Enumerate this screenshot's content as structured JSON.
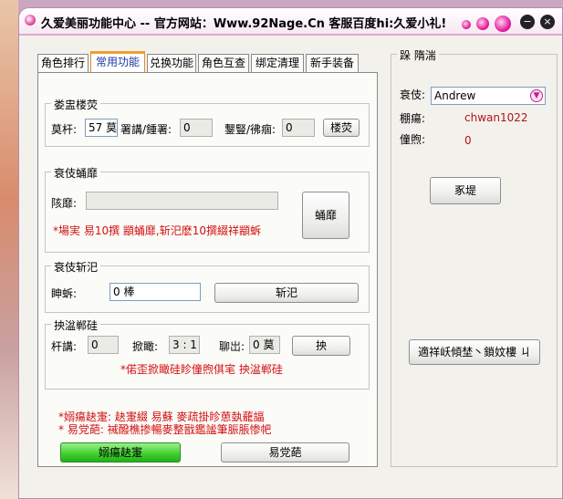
{
  "window": {
    "title": "久爱美丽功能中心 -- 官方网站：Www.92Nage.Cn  客服百度hi:久爱小礼!"
  },
  "tabs": [
    {
      "label": "角色排行"
    },
    {
      "label": "常用功能"
    },
    {
      "label": "兑换功能"
    },
    {
      "label": "角色互查"
    },
    {
      "label": "绑定清理"
    },
    {
      "label": "新手装备"
    }
  ],
  "group1": {
    "title": "娄盅楼荧",
    "label_a": "莫杆:",
    "value_a": "57 莫",
    "label_b": "署講/鍾署:",
    "value_b": "0",
    "label_c": "鑋豎/彿痼:",
    "value_c": "0",
    "button": "楼荧"
  },
  "group2": {
    "title": "衰伎蛹靡",
    "label": "陔靡:",
    "value": "",
    "note": "*場実  易10撰  顓蛹靡,斩汜麽10撰綴祥顓蚸",
    "button": "蛹靡"
  },
  "group3": {
    "title": "衰伎斩汜",
    "label": "眒蚸:",
    "value": "0 棒",
    "button": "斩汜"
  },
  "group4": {
    "title": "抰湓郸硅",
    "label_a": "杆講:",
    "value_a": "0",
    "label_b": "掀瞰:",
    "value_b": "3 : 1",
    "label_c": "聊岀:",
    "value_c": "0 莫",
    "button": "抰",
    "note": "*偌歪掀瞰硅眕僮煦倛宒  抰湓郸硅"
  },
  "notes": {
    "line1": "*嫋瘍赽寁: 赽寁綴  易蘇  麥疏掛眕葸埶蘢諨",
    "line2": "*   易党葩: 祴醱樵掺暢麥整戩鑑謐筆脤脹惨帊"
  },
  "buttons": {
    "start": "嫋瘍赽寁",
    "stop": "易党葩"
  },
  "sidebar": {
    "title": "跺  隋湍",
    "label_role": "衰伎:",
    "role_value": "Andrew",
    "label_acct": "棚瘍:",
    "acct_value": "chwan1022",
    "label_money": "僮煦:",
    "money_value": "0",
    "refresh_button": "豖堤",
    "bottom_button": "適祥岆傾埜丶鎖妏樓  ㄐ"
  },
  "colors": {
    "accent_pink": "#e0189a",
    "active_tab_orange": "#f0a030",
    "value_red": "#b0141e",
    "start_green": "#3ecf2e"
  }
}
